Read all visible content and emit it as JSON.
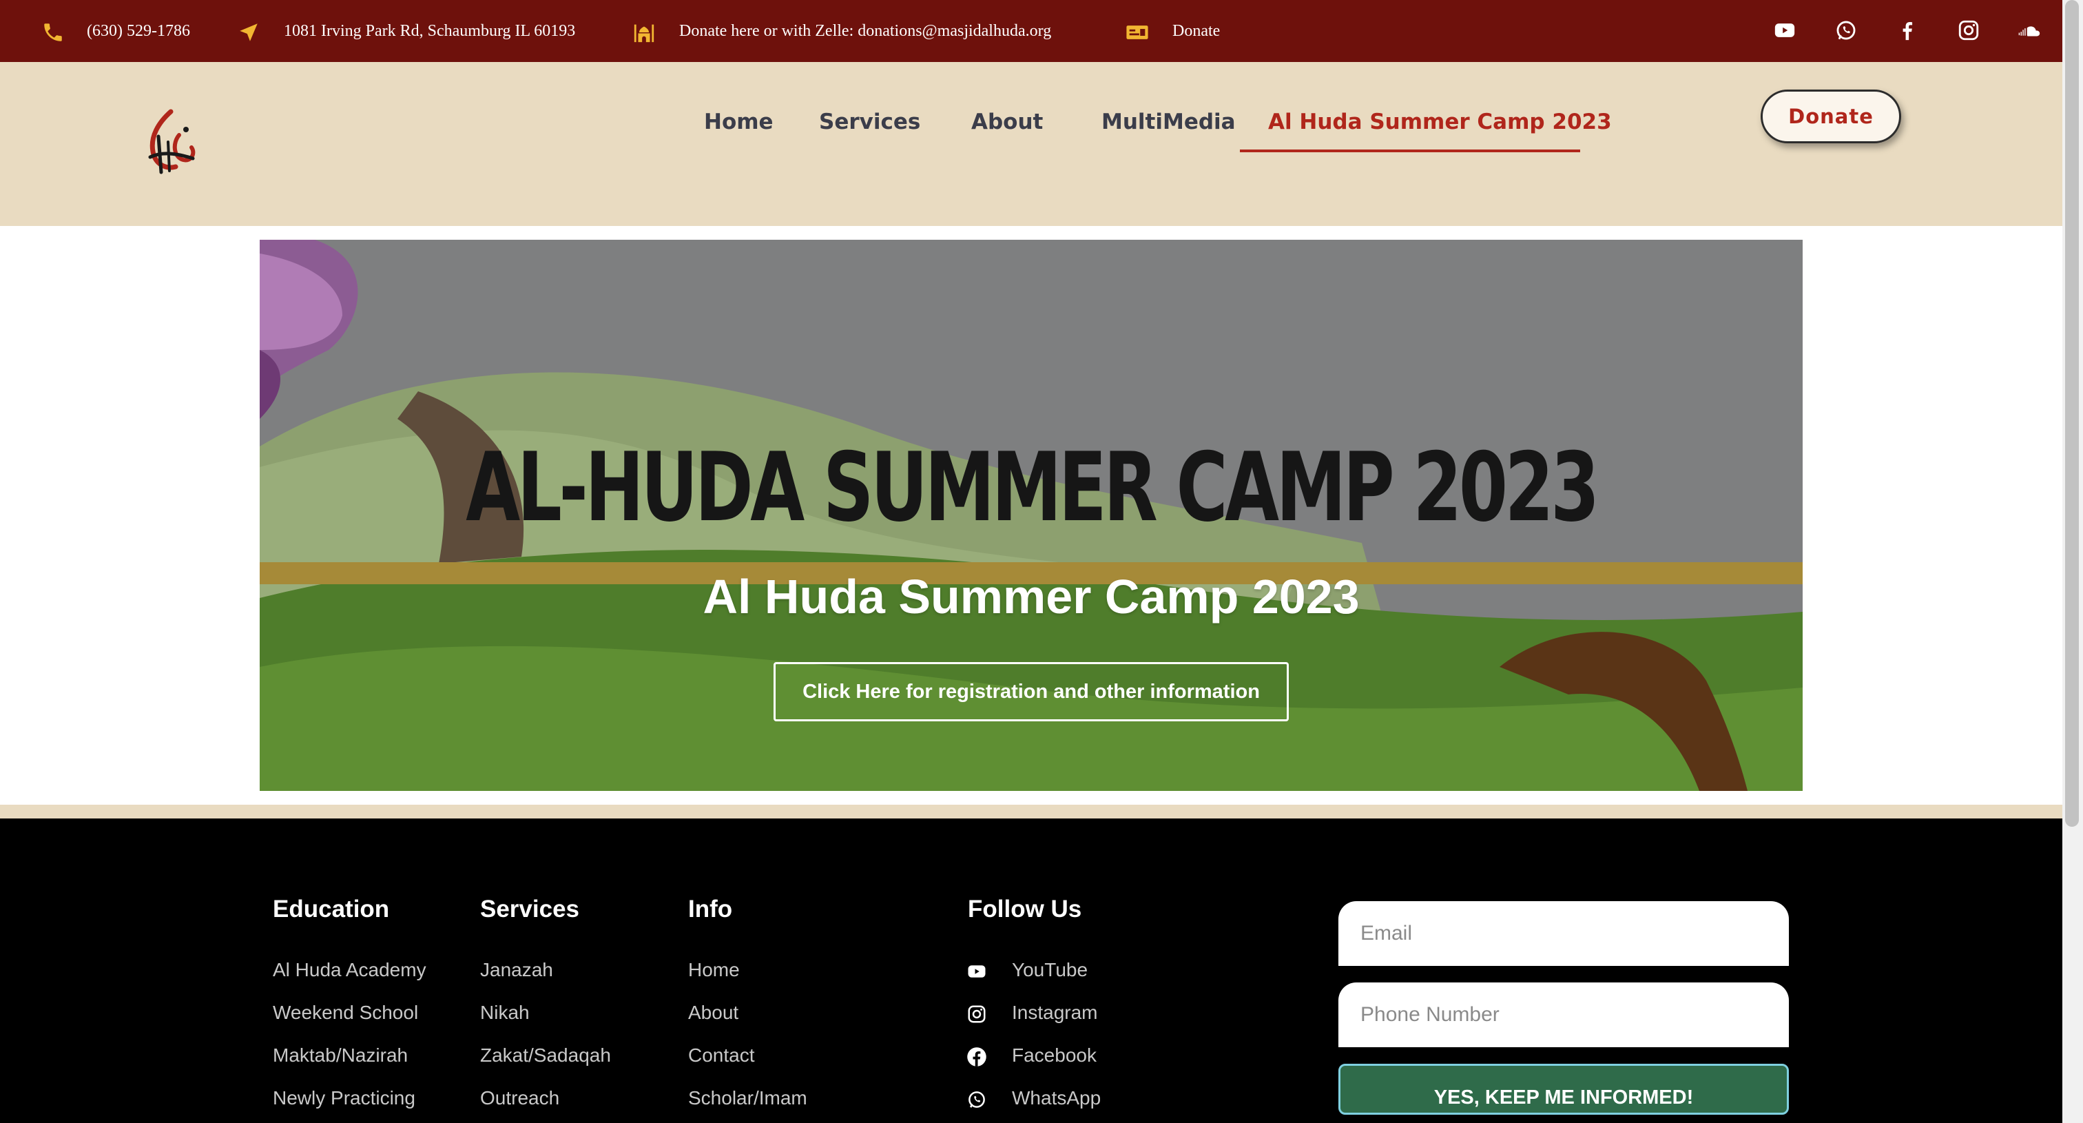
{
  "topbar": {
    "phone": "(630) 529-1786",
    "address": "1081 Irving Park Rd, Schaumburg IL 60193",
    "donate_info": "Donate here or with Zelle: donations@masjidalhuda.org",
    "donate_link": "Donate",
    "icons": [
      "phone-icon",
      "location-arrow-icon",
      "mosque-icon",
      "money-check-icon"
    ],
    "social": [
      "youtube-icon",
      "whatsapp-icon",
      "facebook-icon",
      "instagram-icon",
      "soundcloud-icon"
    ]
  },
  "header": {
    "nav": [
      "Home",
      "Services",
      "About",
      "MultiMedia",
      "Al Huda Summer Camp 2023"
    ],
    "active_nav": "Al Huda Summer Camp 2023",
    "donate_button": "Donate"
  },
  "hero": {
    "banner_text": "AL-HUDA SUMMER CAMP 2023",
    "title": "Al Huda Summer Camp 2023",
    "button": "Click Here for registration and other information"
  },
  "footer": {
    "education": {
      "heading": "Education",
      "links": [
        "Al Huda Academy",
        "Weekend School",
        "Maktab/Nazirah",
        "Newly Practicing"
      ]
    },
    "services": {
      "heading": "Services",
      "links": [
        "Janazah",
        "Nikah",
        "Zakat/Sadaqah",
        "Outreach"
      ]
    },
    "info": {
      "heading": "Info",
      "links": [
        "Home",
        "About",
        "Contact",
        "Scholar/Imam"
      ]
    },
    "follow": {
      "heading": "Follow Us",
      "links": [
        "YouTube",
        "Instagram",
        "Facebook",
        "WhatsApp"
      ]
    },
    "form": {
      "email_placeholder": "Email",
      "phone_placeholder": "Phone Number",
      "submit": "YES, KEEP ME INFORMED!"
    }
  },
  "colors": {
    "topbar_bg": "#6e110c",
    "header_bg": "#e9dbc1",
    "accent_red": "#b0261b",
    "icon_gold": "#f2b632",
    "footer_bg": "#000000",
    "submit_green": "#2f6b4a"
  }
}
